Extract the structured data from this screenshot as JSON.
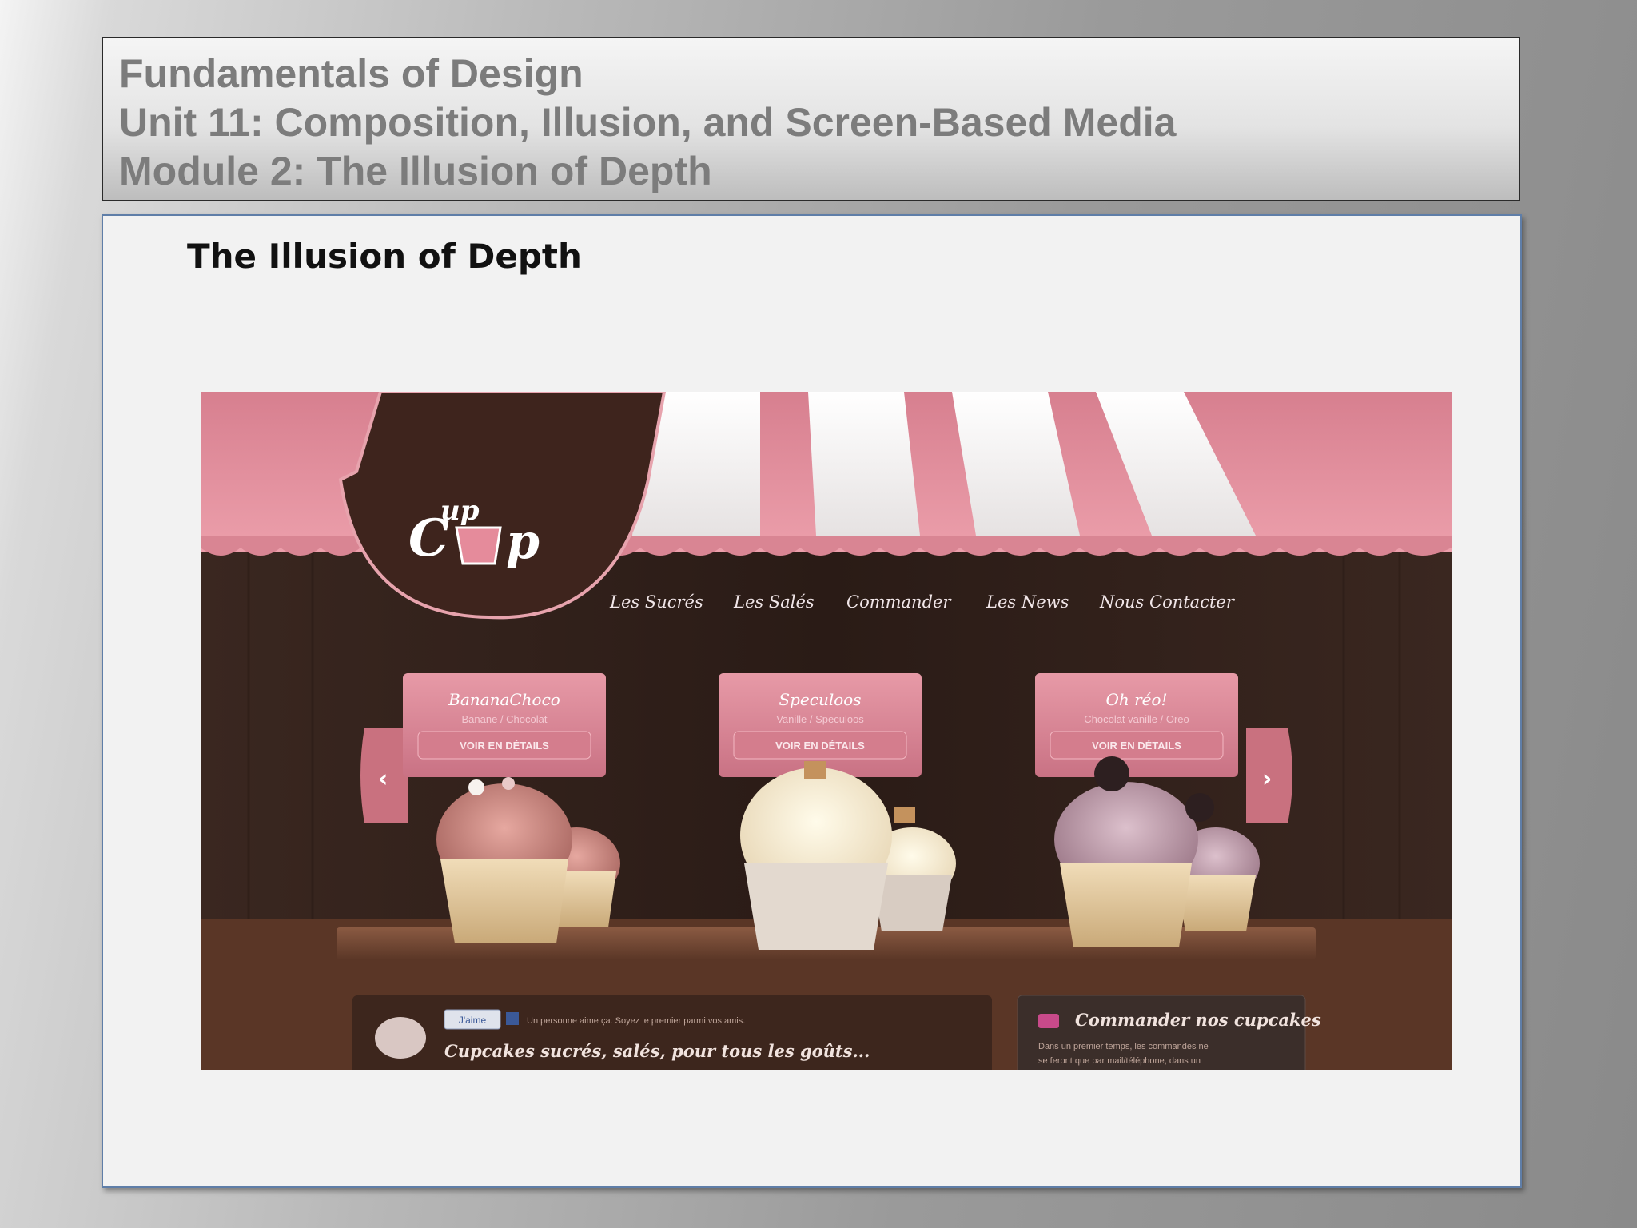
{
  "header": {
    "line1": "Fundamentals of Design",
    "line2": "Unit 11: Composition, Illusion, and Screen-Based Media",
    "line3": "Module 2: The Illusion of Depth"
  },
  "slide": {
    "title": "The Illusion of Depth"
  },
  "screenshot": {
    "logo_text": "Cup Cup",
    "nav": [
      "Les Sucrés",
      "Les Salés",
      "Commander",
      "Les News",
      "Nous Contacter"
    ],
    "cards": [
      {
        "title": "BananaChoco",
        "subtitle": "Banane / Chocolat",
        "button": "VOIR EN DÉTAILS"
      },
      {
        "title": "Speculoos",
        "subtitle": "Vanille / Speculoos",
        "button": "VOIR EN DÉTAILS"
      },
      {
        "title": "Oh réo!",
        "subtitle": "Chocolat vanille / Oreo",
        "button": "VOIR EN DÉTAILS"
      }
    ],
    "prev_arrow": "‹",
    "next_arrow": "›",
    "like_label": "J'aime",
    "like_text": "Un personne aime ça. Soyez le premier parmi vos amis.",
    "tagline": "Cupcakes sucrés, salés, pour tous les goûts...",
    "order_title": "Commander nos cupcakes",
    "order_text_1": "Dans un premier temps, les commandes ne",
    "order_text_2": "se feront que par mail/téléphone, dans un",
    "colors": {
      "awning_pink": "#e0909d",
      "awning_white": "#f7f3f3",
      "wood_dark": "#2b1c16",
      "shelf_brown": "#6b4330"
    }
  }
}
